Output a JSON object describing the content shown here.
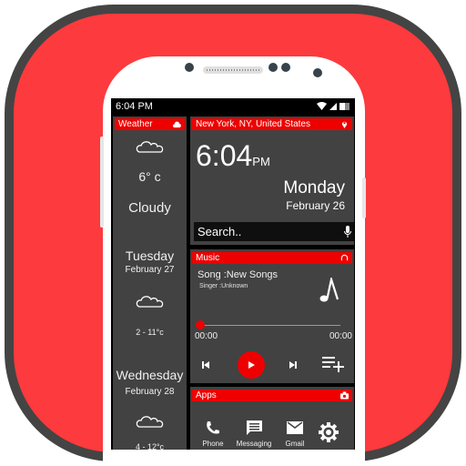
{
  "status_bar": {
    "time": "6:04 PM",
    "icons": [
      "wifi-icon",
      "signal-icon",
      "battery-icon"
    ]
  },
  "weather": {
    "title": "Weather",
    "title_icon": "cloud-icon",
    "current": {
      "icon": "cloudy-icon",
      "temp": "6° c",
      "condition": "Cloudy"
    },
    "forecast": [
      {
        "day": "Tuesday",
        "date": "February 27",
        "icon": "cloudy-icon",
        "range": "2 - 11°c"
      },
      {
        "day": "Wednesday",
        "date": "February 28",
        "icon": "cloudy-icon",
        "range": "4 - 12°c"
      }
    ]
  },
  "clock": {
    "location": "New York,  NY, United States",
    "location_icon": "location-pin-icon",
    "time": "6:04",
    "ampm": "PM",
    "day": "Monday",
    "date": "February 26",
    "search_placeholder": "Search..",
    "mic_icon": "microphone-icon"
  },
  "music": {
    "title": "Music",
    "title_icon": "headphones-icon",
    "song": "Song :New Songs",
    "singer": "Singer :Unknown",
    "elapsed": "00:00",
    "duration": "00:00",
    "progress": 0,
    "controls": [
      "previous-icon",
      "play-icon",
      "next-icon",
      "playlist-add-icon"
    ]
  },
  "apps": {
    "title": "Apps",
    "title_icon": "camera-icon",
    "items": [
      {
        "label": "Phone",
        "icon": "phone-icon"
      },
      {
        "label": "Messaging",
        "icon": "message-icon"
      },
      {
        "label": "Gmail",
        "icon": "mail-icon"
      },
      {
        "label": "",
        "icon": "settings-gear-icon"
      }
    ]
  },
  "colors": {
    "accent": "#ee0000",
    "background": "#fd3a3d",
    "panel": "#424242"
  }
}
